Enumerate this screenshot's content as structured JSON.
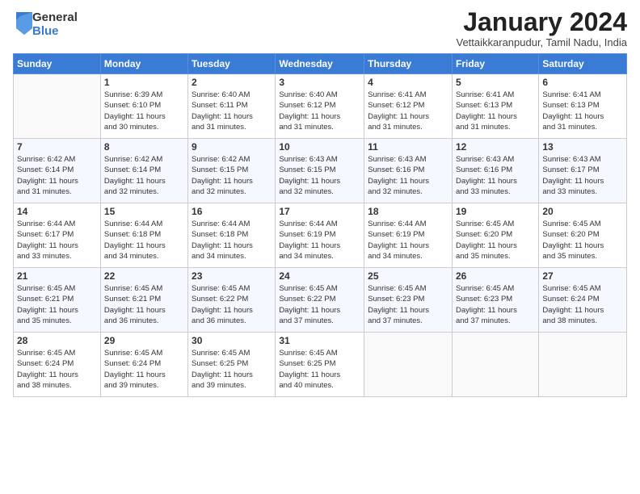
{
  "logo": {
    "general": "General",
    "blue": "Blue"
  },
  "header": {
    "title": "January 2024",
    "location": "Vettaikkaranpudur, Tamil Nadu, India"
  },
  "weekdays": [
    "Sunday",
    "Monday",
    "Tuesday",
    "Wednesday",
    "Thursday",
    "Friday",
    "Saturday"
  ],
  "weeks": [
    [
      {
        "day": "",
        "info": ""
      },
      {
        "day": "1",
        "info": "Sunrise: 6:39 AM\nSunset: 6:10 PM\nDaylight: 11 hours\nand 30 minutes."
      },
      {
        "day": "2",
        "info": "Sunrise: 6:40 AM\nSunset: 6:11 PM\nDaylight: 11 hours\nand 31 minutes."
      },
      {
        "day": "3",
        "info": "Sunrise: 6:40 AM\nSunset: 6:12 PM\nDaylight: 11 hours\nand 31 minutes."
      },
      {
        "day": "4",
        "info": "Sunrise: 6:41 AM\nSunset: 6:12 PM\nDaylight: 11 hours\nand 31 minutes."
      },
      {
        "day": "5",
        "info": "Sunrise: 6:41 AM\nSunset: 6:13 PM\nDaylight: 11 hours\nand 31 minutes."
      },
      {
        "day": "6",
        "info": "Sunrise: 6:41 AM\nSunset: 6:13 PM\nDaylight: 11 hours\nand 31 minutes."
      }
    ],
    [
      {
        "day": "7",
        "info": "Sunrise: 6:42 AM\nSunset: 6:14 PM\nDaylight: 11 hours\nand 31 minutes."
      },
      {
        "day": "8",
        "info": "Sunrise: 6:42 AM\nSunset: 6:14 PM\nDaylight: 11 hours\nand 32 minutes."
      },
      {
        "day": "9",
        "info": "Sunrise: 6:42 AM\nSunset: 6:15 PM\nDaylight: 11 hours\nand 32 minutes."
      },
      {
        "day": "10",
        "info": "Sunrise: 6:43 AM\nSunset: 6:15 PM\nDaylight: 11 hours\nand 32 minutes."
      },
      {
        "day": "11",
        "info": "Sunrise: 6:43 AM\nSunset: 6:16 PM\nDaylight: 11 hours\nand 32 minutes."
      },
      {
        "day": "12",
        "info": "Sunrise: 6:43 AM\nSunset: 6:16 PM\nDaylight: 11 hours\nand 33 minutes."
      },
      {
        "day": "13",
        "info": "Sunrise: 6:43 AM\nSunset: 6:17 PM\nDaylight: 11 hours\nand 33 minutes."
      }
    ],
    [
      {
        "day": "14",
        "info": "Sunrise: 6:44 AM\nSunset: 6:17 PM\nDaylight: 11 hours\nand 33 minutes."
      },
      {
        "day": "15",
        "info": "Sunrise: 6:44 AM\nSunset: 6:18 PM\nDaylight: 11 hours\nand 34 minutes."
      },
      {
        "day": "16",
        "info": "Sunrise: 6:44 AM\nSunset: 6:18 PM\nDaylight: 11 hours\nand 34 minutes."
      },
      {
        "day": "17",
        "info": "Sunrise: 6:44 AM\nSunset: 6:19 PM\nDaylight: 11 hours\nand 34 minutes."
      },
      {
        "day": "18",
        "info": "Sunrise: 6:44 AM\nSunset: 6:19 PM\nDaylight: 11 hours\nand 34 minutes."
      },
      {
        "day": "19",
        "info": "Sunrise: 6:45 AM\nSunset: 6:20 PM\nDaylight: 11 hours\nand 35 minutes."
      },
      {
        "day": "20",
        "info": "Sunrise: 6:45 AM\nSunset: 6:20 PM\nDaylight: 11 hours\nand 35 minutes."
      }
    ],
    [
      {
        "day": "21",
        "info": "Sunrise: 6:45 AM\nSunset: 6:21 PM\nDaylight: 11 hours\nand 35 minutes."
      },
      {
        "day": "22",
        "info": "Sunrise: 6:45 AM\nSunset: 6:21 PM\nDaylight: 11 hours\nand 36 minutes."
      },
      {
        "day": "23",
        "info": "Sunrise: 6:45 AM\nSunset: 6:22 PM\nDaylight: 11 hours\nand 36 minutes."
      },
      {
        "day": "24",
        "info": "Sunrise: 6:45 AM\nSunset: 6:22 PM\nDaylight: 11 hours\nand 37 minutes."
      },
      {
        "day": "25",
        "info": "Sunrise: 6:45 AM\nSunset: 6:23 PM\nDaylight: 11 hours\nand 37 minutes."
      },
      {
        "day": "26",
        "info": "Sunrise: 6:45 AM\nSunset: 6:23 PM\nDaylight: 11 hours\nand 37 minutes."
      },
      {
        "day": "27",
        "info": "Sunrise: 6:45 AM\nSunset: 6:24 PM\nDaylight: 11 hours\nand 38 minutes."
      }
    ],
    [
      {
        "day": "28",
        "info": "Sunrise: 6:45 AM\nSunset: 6:24 PM\nDaylight: 11 hours\nand 38 minutes."
      },
      {
        "day": "29",
        "info": "Sunrise: 6:45 AM\nSunset: 6:24 PM\nDaylight: 11 hours\nand 39 minutes."
      },
      {
        "day": "30",
        "info": "Sunrise: 6:45 AM\nSunset: 6:25 PM\nDaylight: 11 hours\nand 39 minutes."
      },
      {
        "day": "31",
        "info": "Sunrise: 6:45 AM\nSunset: 6:25 PM\nDaylight: 11 hours\nand 40 minutes."
      },
      {
        "day": "",
        "info": ""
      },
      {
        "day": "",
        "info": ""
      },
      {
        "day": "",
        "info": ""
      }
    ]
  ]
}
